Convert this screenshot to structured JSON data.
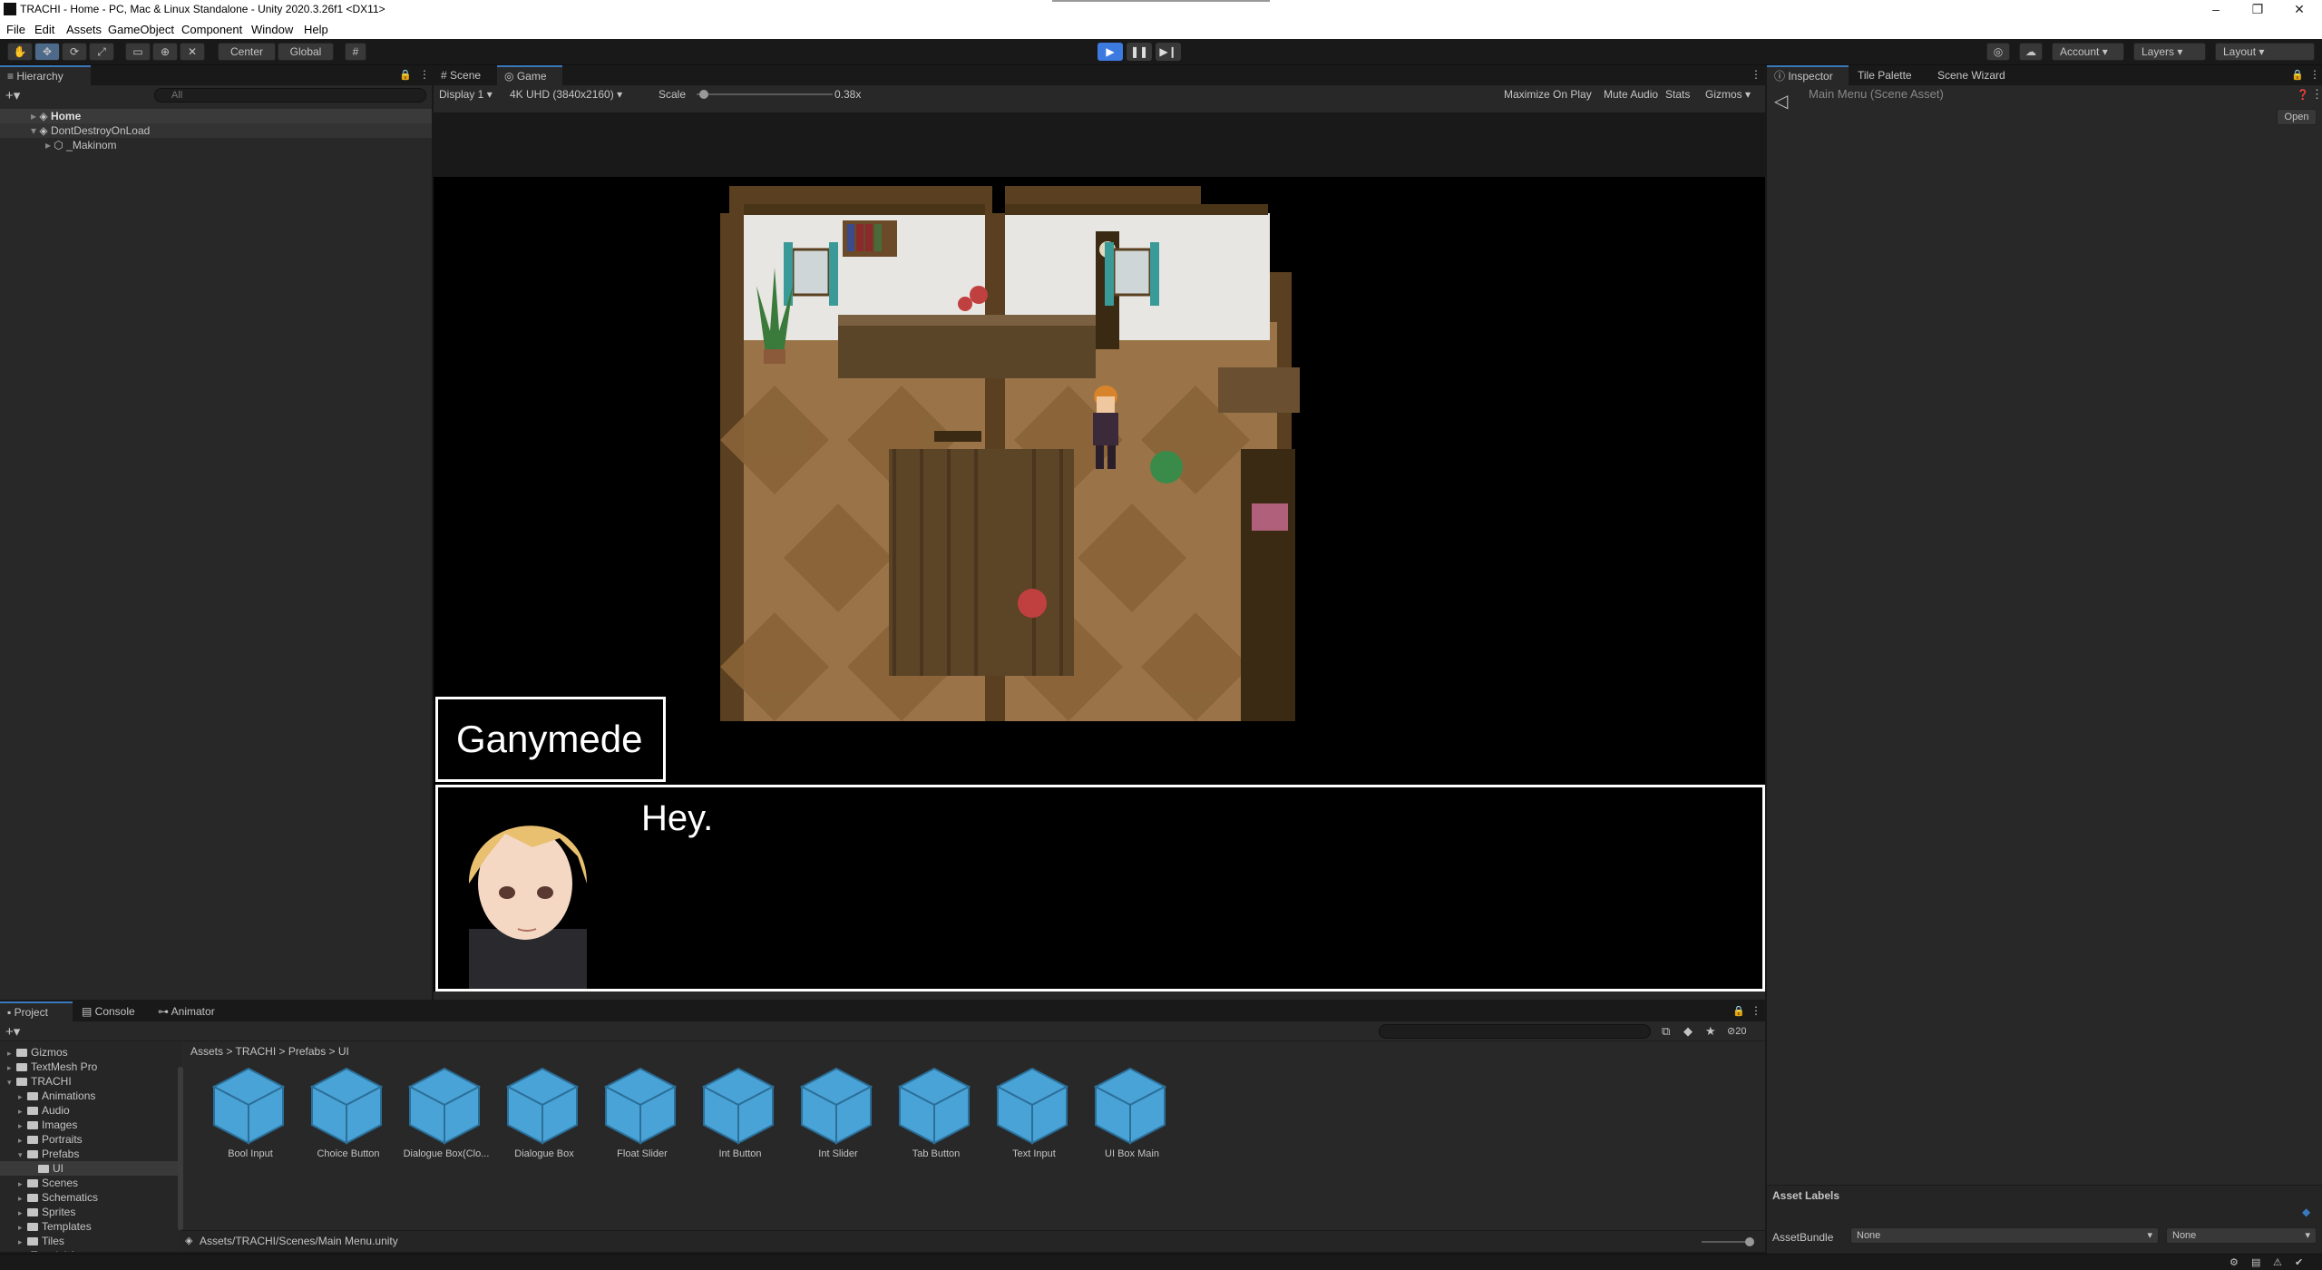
{
  "window": {
    "title": "TRACHI - Home - PC, Mac & Linux Standalone - Unity 2020.3.26f1 <DX11>",
    "controls": [
      "–",
      "❐",
      "✕"
    ]
  },
  "menu": [
    "File",
    "Edit",
    "Assets",
    "GameObject",
    "Component",
    "Window",
    "Help"
  ],
  "toolbar": {
    "pivot": "Center",
    "space": "Global",
    "account": "Account",
    "layers": "Layers",
    "layout": "Layout"
  },
  "hierarchy": {
    "tab": "Hierarchy",
    "search_placeholder": "All",
    "items": [
      {
        "label": "Home"
      },
      {
        "label": "DontDestroyOnLoad"
      },
      {
        "label": "_Makinom"
      }
    ]
  },
  "game_view": {
    "tabs": [
      "Scene",
      "Game"
    ],
    "display": "Display 1",
    "resolution": "4K UHD (3840x2160)",
    "scale_label": "Scale",
    "scale_value": "0.38x",
    "scale_level": 0.05,
    "options": [
      "Maximize On Play",
      "Mute Audio",
      "Stats",
      "Gizmos"
    ]
  },
  "dialogue": {
    "speaker": "Ganymede",
    "text": "Hey."
  },
  "inspector": {
    "tabs": [
      "Inspector",
      "Tile Palette",
      "Scene Wizard"
    ],
    "asset_name": "Main Menu (Scene Asset)",
    "open_button": "Open",
    "asset_labels": "Asset Labels",
    "asset_bundle_label": "AssetBundle",
    "bundle_value": "None",
    "variant_value": "None"
  },
  "project": {
    "tabs": [
      "Project",
      "Console",
      "Animator"
    ],
    "hidden_count": "20",
    "tree": [
      {
        "label": "Gizmos",
        "depth": 1
      },
      {
        "label": "TextMesh Pro",
        "depth": 1
      },
      {
        "label": "TRACHI",
        "depth": 1
      },
      {
        "label": "Animations",
        "depth": 2
      },
      {
        "label": "Audio",
        "depth": 2
      },
      {
        "label": "Images",
        "depth": 2
      },
      {
        "label": "Portraits",
        "depth": 2
      },
      {
        "label": "Prefabs",
        "depth": 2
      },
      {
        "label": "UI",
        "depth": 3
      },
      {
        "label": "Scenes",
        "depth": 2
      },
      {
        "label": "Schematics",
        "depth": 2
      },
      {
        "label": "Sprites",
        "depth": 2
      },
      {
        "label": "Templates",
        "depth": 2
      },
      {
        "label": "Tiles",
        "depth": 2
      },
      {
        "label": "Tutorial Assets",
        "depth": 1
      }
    ],
    "breadcrumb": [
      "Assets",
      "TRACHI",
      "Prefabs",
      "UI"
    ],
    "assets": [
      "Bool Input",
      "Choice Button",
      "Dialogue Box(Clo...",
      "Dialogue Box",
      "Float Slider",
      "Int Button",
      "Int Slider",
      "Tab Button",
      "Text Input",
      "UI Box Main"
    ],
    "footer_path": "Assets/TRACHI/Scenes/Main Menu.unity"
  },
  "colors": {
    "accent": "#3a79bb",
    "panel": "#282828",
    "dark": "#191919",
    "prefab_blue": "#4aa3d6"
  }
}
